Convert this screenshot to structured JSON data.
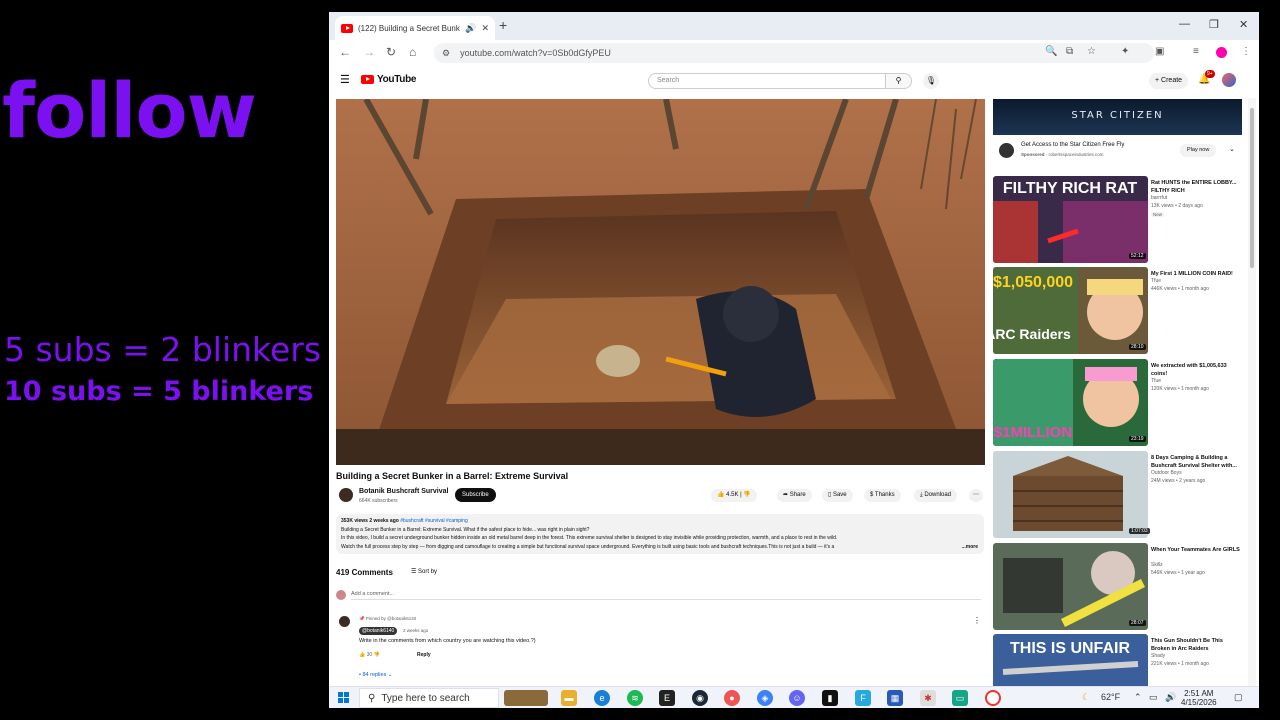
{
  "overlay": {
    "follow": "follow",
    "line1": "5 subs = 2 blinkers",
    "line2": "10 subs = 5 blinkers",
    "color": "#7b11f0"
  },
  "browser": {
    "tab_title": "(122) Building a Secret Bunk",
    "url": "youtube.com/watch?v=0Sb0dGfyPEU"
  },
  "youtube": {
    "logo_text": "YouTube",
    "search_placeholder": "Search",
    "create_label": "Create",
    "notification_count": "9+"
  },
  "video": {
    "title": "Building a Secret Bunker in a Barrel: Extreme Survival",
    "channel": "Botanik Bushcraft Survival",
    "subscribers": "664K subscribers",
    "subscribe_label": "Subscribe",
    "likes": "4.5K",
    "share_label": "Share",
    "save_label": "Save",
    "thanks_label": "Thanks",
    "download_label": "Download",
    "description": {
      "meta": "353K views  2 weeks ago",
      "tags": "#bushcraft #survival #camping",
      "line1": "Building a Secret Bunker in a Barrel: Extreme Survival. What if the safest place to hide... was right in plain sight?",
      "line2": "In this video, I build a secret underground bunker hidden inside an old metal barrel deep in the forest. This extreme survival shelter is designed to stay invisible while providing protection, warmth, and a place to rest in the wild.",
      "line3": "Watch the full process step by step — from digging and camouflage to creating a simple but functional survival space underground. Everything is built using basic tools and bushcraft techniques.This is not just a build — it's a",
      "more": "...more"
    }
  },
  "comments": {
    "count_label": "419 Comments",
    "sort_label": "Sort by",
    "add_placeholder": "Add a comment...",
    "pinned_by": "Pinned by @botanik6140",
    "author": "@botanik6140",
    "time": "2 weeks ago",
    "text": "Write in the comments from which country you are watching this video.?)",
    "likes": "30",
    "reply_label": "Reply",
    "replies_label": "84 replies"
  },
  "ad": {
    "banner_text": "STAR CITIZEN",
    "title": "Get Access to the Star Citizen Free Fly",
    "sponsored_label": "Sponsored",
    "domain": "robertsspaceindustries.com",
    "cta": "Play now"
  },
  "recommendations": [
    {
      "thumb_text": "FILTHY RICH RAT",
      "title": "Rat HUNTS the ENTIRE LOBBY... FILTHY RICH",
      "channel": "barrrfut",
      "meta": "13K views • 2 days ago",
      "badge": "New",
      "duration": "52:12"
    },
    {
      "thumb_text": "$1,050,000",
      "thumb_sub": "ARC Raiders",
      "title": "My First 1 MILLION COIN RAID!",
      "channel": "Tfue",
      "meta": "446K views • 1 month ago",
      "duration": "28:10"
    },
    {
      "thumb_text": "$1MILLION",
      "title": "We extracted with $1,005,633 coins!",
      "channel": "Tfue",
      "meta": "120K views • 1 month ago",
      "duration": "23:19"
    },
    {
      "title": "8 Days Camping & Building a Bushcraft Survival Shelter with...",
      "channel": "Outdoor Boys",
      "meta": "24M views • 2 years ago",
      "duration": "1:07:03"
    },
    {
      "title": "When Your Teammates Are GIRLS",
      "channel": "Skillz",
      "meta": "546K views • 1 year ago",
      "duration": "28:07"
    },
    {
      "thumb_text": "THIS IS UNFAIR",
      "title": "This Gun Shouldn't Be This Broken in Arc Raiders",
      "channel": "Shady",
      "meta": "221K views • 1 month ago",
      "duration": ""
    }
  ],
  "taskbar": {
    "search_placeholder": "Type here to search",
    "weather": "62°F",
    "time": "2:51 AM",
    "date": "4/15/2026"
  }
}
